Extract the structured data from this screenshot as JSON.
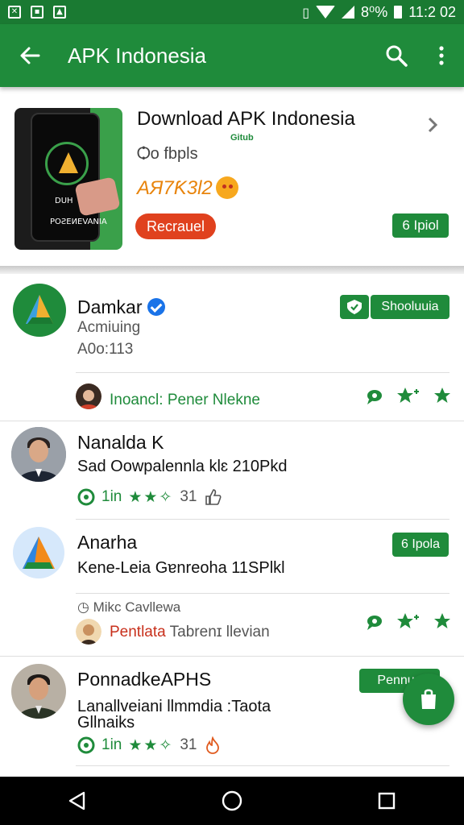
{
  "status_bar": {
    "time": "11:2 02",
    "battery": "8⁰%"
  },
  "app_bar": {
    "title": "APK Indonesia"
  },
  "featured": {
    "title": "Download APK Indonesia",
    "badge": "Gitub",
    "subtitle": "Ѻo fbpls",
    "code": "AЯ7Ƙ3Ɩ2",
    "image_line1": "DUH",
    "image_line2": "POƧEИEVANIA",
    "primary_button": "Recrauel",
    "secondary_button": "6 Ipiol"
  },
  "feed": {
    "item1": {
      "name": "Damkar",
      "subtitle": "Acmiuing",
      "meta": "A0o:113",
      "tag_button": "Shooluuia",
      "comment": "Inoancl: Pener Nlekne"
    },
    "item2": {
      "name": "Nanalda K",
      "text": "Sad Oowpalennla klɛ 210Pkd",
      "likes": "1in",
      "stars": "★★✧",
      "count": "31"
    },
    "item3": {
      "name": "Anarha",
      "text": "Kene-Leia Gɐnreoha 11SPlkl",
      "tag_button": "6 Ipola",
      "meta": "Mikc Cavllewa",
      "comment_prefix": "Pentlata",
      "comment_rest": " Tabrenɪ Ɩlevian"
    },
    "item4": {
      "name": "PonnadkeAPHS",
      "text_line1": "Lanallveiani llmmdia :Taota",
      "text_line2": "Gllnaiks",
      "tag_button": "Pennug",
      "likes": "1in",
      "stars": "★★✧",
      "count": "31"
    }
  },
  "colors": {
    "primary": "#1f8b3b",
    "status": "#1a7a32",
    "accent_red": "#e0411e",
    "accent_orange": "#e8840c",
    "verified": "#1a73e8"
  }
}
